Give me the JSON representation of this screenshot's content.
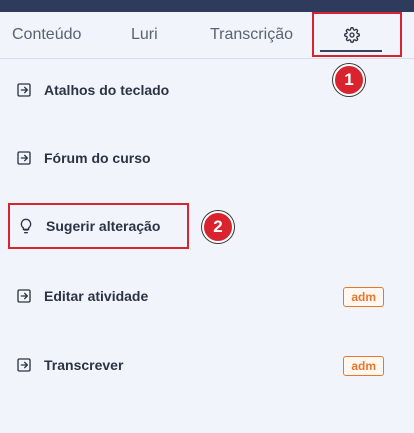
{
  "tabs": [
    {
      "label": "Conteúdo"
    },
    {
      "label": "Luri"
    },
    {
      "label": "Transcrição"
    }
  ],
  "settings_tab": {
    "icon": "gear-icon"
  },
  "markers": [
    "1",
    "2"
  ],
  "menu": {
    "items": [
      {
        "label": "Atalhos do teclado",
        "icon": "arrow-right-box-icon"
      },
      {
        "label": "Fórum do curso",
        "icon": "arrow-right-box-icon"
      },
      {
        "label": "Sugerir alteração",
        "icon": "lightbulb-icon"
      },
      {
        "label": "Editar atividade",
        "icon": "arrow-right-box-icon",
        "badge": "adm"
      },
      {
        "label": "Transcrever",
        "icon": "arrow-right-box-icon",
        "badge": "adm"
      }
    ]
  },
  "colors": {
    "accent": "#d9232e",
    "badge": "#e8772e",
    "header": "#2f3b5c",
    "background": "#f2f4fb"
  }
}
